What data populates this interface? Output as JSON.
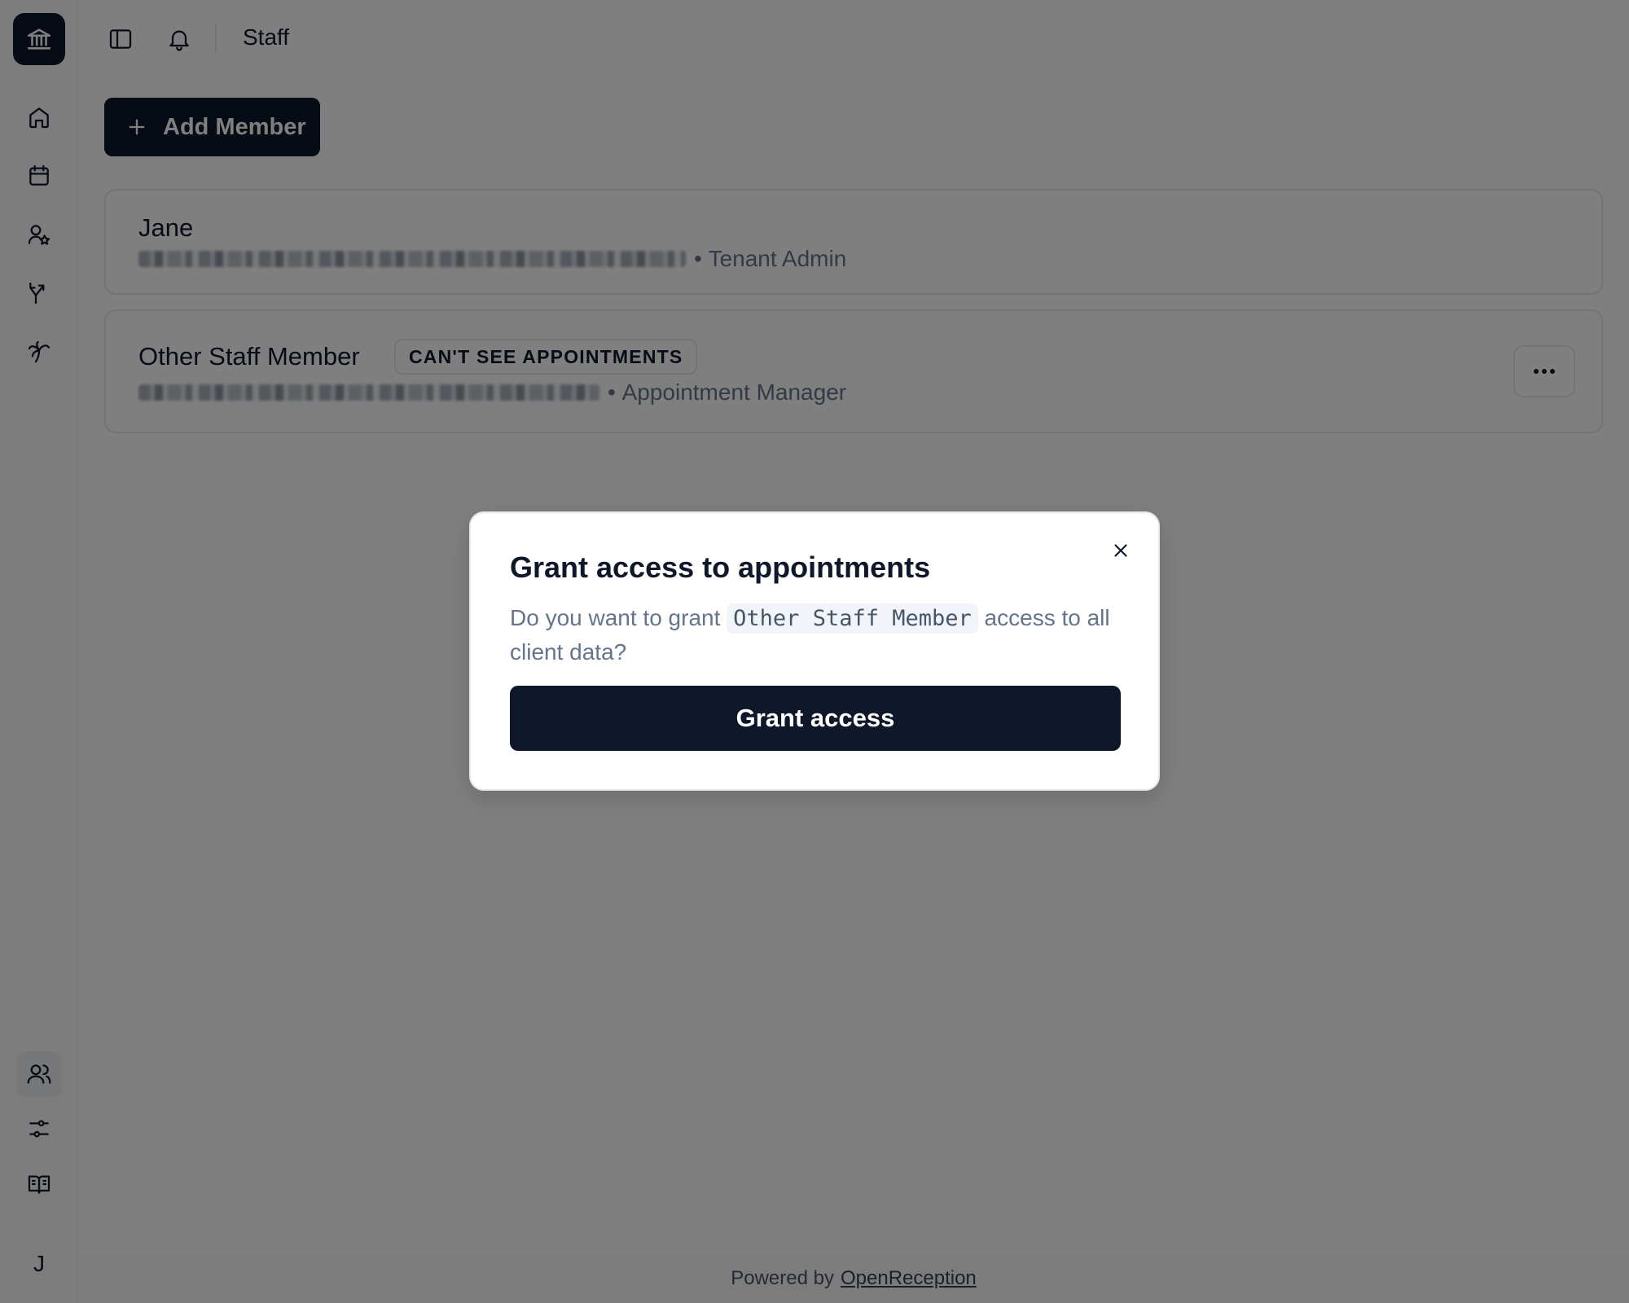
{
  "page": {
    "title": "Staff"
  },
  "sidebar": {
    "logo_icon": "bank-icon",
    "nav": [
      {
        "id": "home",
        "icon": "home-icon"
      },
      {
        "id": "calendar",
        "icon": "calendar-icon"
      },
      {
        "id": "clients",
        "icon": "user-star-icon"
      },
      {
        "id": "routing",
        "icon": "split-icon"
      },
      {
        "id": "vacation",
        "icon": "palm-tree-icon"
      }
    ],
    "bottom_nav": [
      {
        "id": "staff",
        "icon": "users-icon",
        "active": true
      },
      {
        "id": "settings",
        "icon": "sliders-icon"
      },
      {
        "id": "docs",
        "icon": "book-icon"
      }
    ],
    "avatar_initial": "J"
  },
  "toolbar": {
    "add_member_label": "Add Member"
  },
  "staff": [
    {
      "name": "Jane",
      "email_redacted": true,
      "role": "Tenant Admin",
      "badge": ""
    },
    {
      "name": "Other Staff Member",
      "email_redacted": true,
      "role": "Appointment Manager",
      "badge": "CAN'T SEE APPOINTMENTS"
    }
  ],
  "separator": "•",
  "footer": {
    "prefix": "Powered by",
    "link": "OpenReception"
  },
  "dialog": {
    "title": "Grant access to appointments",
    "body_before": "Do you want to grant",
    "member_name": "Other Staff Member",
    "body_after": "access to all client data?",
    "confirm_label": "Grant access"
  },
  "colors": {
    "primary": "#0f172a",
    "muted_text": "#64748b",
    "border": "#e5e7eb"
  }
}
